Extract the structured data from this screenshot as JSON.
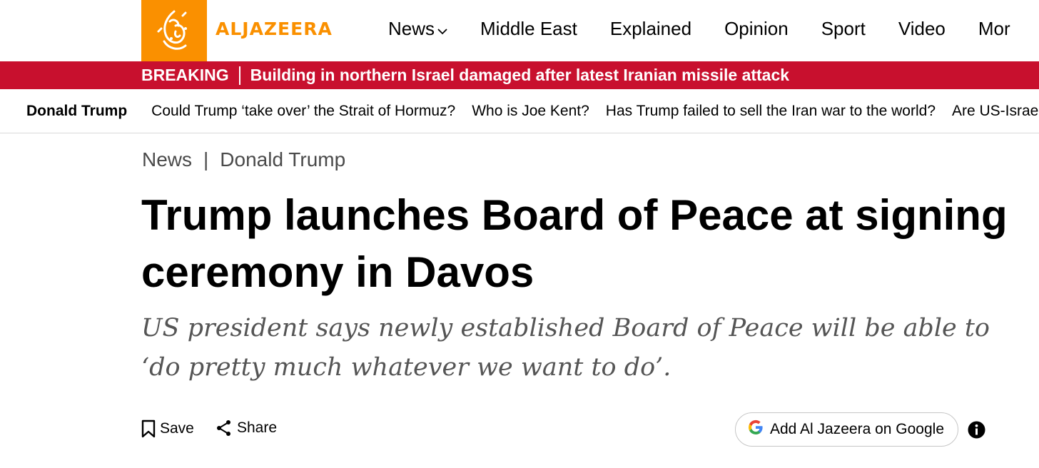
{
  "brand": {
    "name": "ALJAZEERA",
    "logo_color": "#fa9000"
  },
  "nav": {
    "items": [
      {
        "label": "News",
        "has_dropdown": true
      },
      {
        "label": "Middle East"
      },
      {
        "label": "Explained"
      },
      {
        "label": "Opinion"
      },
      {
        "label": "Sport"
      },
      {
        "label": "Video"
      },
      {
        "label": "Mor"
      }
    ]
  },
  "breaking": {
    "tag": "BREAKING",
    "text": "Building in northern Israel damaged after latest Iranian missile attack",
    "color": "#c8102e"
  },
  "topics": {
    "heading": "Donald Trump",
    "links": [
      "Could Trump ‘take over’ the Strait of Hormuz?",
      "Who is Joe Kent?",
      "Has Trump failed to sell the Iran war to the world?",
      "Are US-Israe"
    ]
  },
  "breadcrumb": {
    "section": "News",
    "separator": "|",
    "topic": "Donald Trump"
  },
  "article": {
    "title": "Trump launches Board of Peace at signing ceremony in Davos",
    "subtitle": "US president says newly established Board of Peace will be able to ‘do pretty much whatever we want to do’."
  },
  "actions": {
    "save_label": "Save",
    "share_label": "Share",
    "google_label": "Add Al Jazeera on Google",
    "icons": [
      "bookmark-icon",
      "share-icon",
      "google-icon",
      "info-icon"
    ]
  }
}
